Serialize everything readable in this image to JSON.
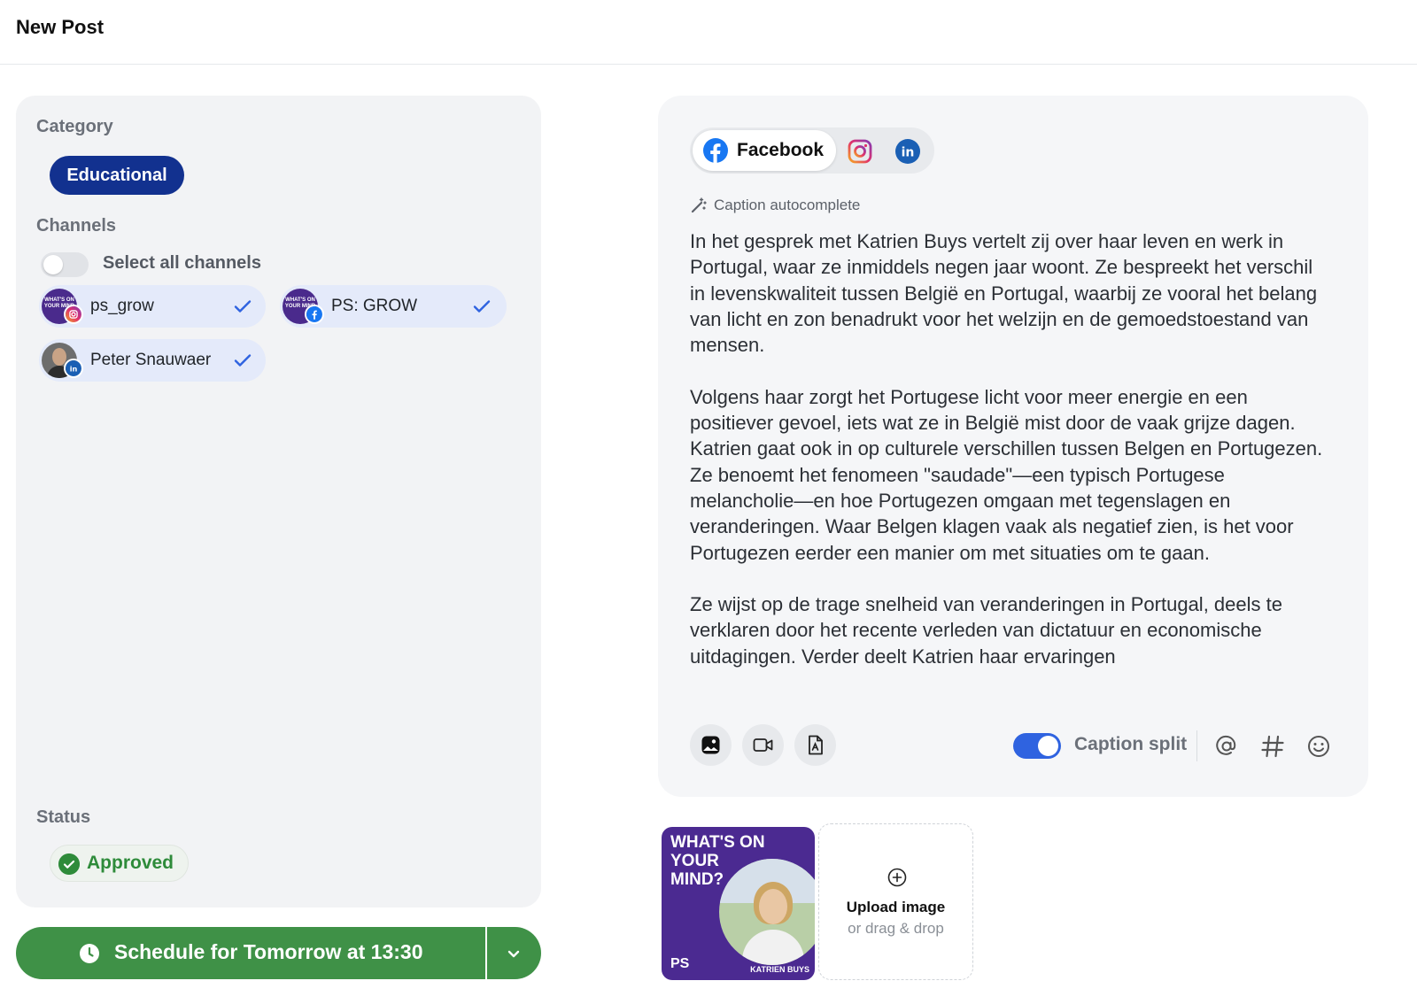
{
  "header": {
    "title": "New Post"
  },
  "left": {
    "category_label": "Category",
    "category_value": "Educational",
    "channels_label": "Channels",
    "select_all_label": "Select all channels",
    "channels": [
      {
        "name": "ps_grow",
        "network": "instagram",
        "selected": true,
        "avatar_text": "WHAT'S ON YOUR MIND"
      },
      {
        "name": "PS: GROW",
        "network": "facebook",
        "selected": true,
        "avatar_text": "WHAT'S ON YOUR MIND"
      },
      {
        "name": "Peter Snauwaer",
        "network": "linkedin",
        "selected": true
      }
    ],
    "status_label": "Status",
    "status_value": "Approved",
    "schedule_label": "Schedule for Tomorrow at 13:30"
  },
  "editor": {
    "tabs": [
      {
        "label": "Facebook",
        "network": "facebook",
        "active": true
      },
      {
        "label": "",
        "network": "instagram",
        "active": false
      },
      {
        "label": "",
        "network": "linkedin",
        "active": false
      }
    ],
    "autocomplete_label": "Caption autocomplete",
    "caption": "In het gesprek met Katrien Buys vertelt zij over haar leven en werk in Portugal, waar ze inmiddels negen jaar woont. Ze bespreekt het verschil in levenskwaliteit tussen België en Portugal, waarbij ze vooral het belang van licht en zon benadrukt voor het welzijn en de gemoedstoestand van mensen.\n\nVolgens haar zorgt het Portugese licht voor meer energie en een positiever gevoel, iets wat ze in België mist door de vaak grijze dagen. Katrien gaat ook in op culturele verschillen tussen Belgen en Portugezen. Ze benoemt het fenomeen \"saudade\"—een typisch Portugese melancholie—en hoe Portugezen omgaan met tegenslagen en veranderingen. Waar Belgen klagen vaak als negatief zien, is het voor Portugezen eerder een manier om met situaties om te gaan.\n\nZe wijst op de trage snelheid van veranderingen in Portugal, deels te verklaren door het recente verleden van dictatuur en economische uitdagingen. Verder deelt Katrien haar ervaringen",
    "caption_split_label": "Caption split",
    "caption_split_on": true
  },
  "media": {
    "thumbnail": {
      "headline": "WHAT'S ON YOUR MIND?",
      "brand": "PS",
      "person": "KATRIEN BUYS"
    },
    "upload_title": "Upload image",
    "upload_subtitle": "or drag & drop"
  },
  "colors": {
    "accent_blue": "#12318f",
    "toggle_blue": "#2f63e0",
    "approve_green": "#3f9147",
    "panel_bg": "#f2f3f5"
  }
}
